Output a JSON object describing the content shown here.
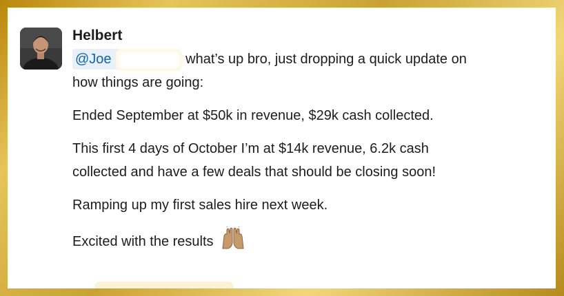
{
  "message": {
    "sender": "Helbert",
    "mention": "@Joe l",
    "first_line": "what’s up bro, just dropping a quick update on",
    "second_line": "how things are going:",
    "paragraph_1": "Ended September at $50k in revenue, $29k cash collected.",
    "paragraph_2_line_1": "This first 4 days of October I’m at $14k revenue, 6.2k cash",
    "paragraph_2_line_2": "collected and have a few deals that should be closing soon!",
    "paragraph_3": "Ramping up my first sales hire next week.",
    "paragraph_4": "Excited with the results",
    "emoji_icon": "raising-hands-emoji"
  },
  "colors": {
    "frame_gold": "#c9a233",
    "mention_bg": "#e8f1fa",
    "mention_text": "#1264a3",
    "text": "#1d1c1d"
  }
}
